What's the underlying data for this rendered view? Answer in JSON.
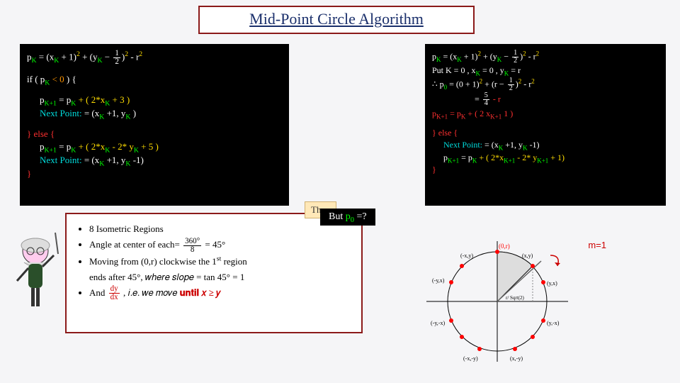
{
  "title": "Mid-Point Circle Algorithm",
  "left_code": {
    "l1a": "p",
    "l1b": "K",
    "l1c": " = (x",
    "l1d": "K",
    "l1e": " + 1)",
    "l1f": "2",
    "l1g": " +  (y",
    "l1h": "K",
    "l1i": " − ",
    "l1j_num": "1",
    "l1j_den": "2",
    "l1k": ")",
    "l1l": "2",
    "l1m": " - r",
    "l1n": "2",
    "l3a": "if ( ",
    "l3b": "p",
    "l3c": "K",
    "l3d": " < 0",
    "l3e": " ) {",
    "l5a": "p",
    "l5b": "K+1",
    "l5c": " = p",
    "l5d": "K",
    "l5e": " + ( 2*x",
    "l5f": "K",
    "l5g": " + 3 )",
    "l6a": "Next Point: ",
    "l6b": "= (x",
    "l6c": "K",
    "l6d": " +1, y",
    "l6e": "K",
    "l6f": " )",
    "l8a": "} else {",
    "l9a": "p",
    "l9b": "K+1",
    "l9c": " = p",
    "l9d": "K",
    "l9e": " + ( 2*x",
    "l9f": "K",
    "l9g": " -  2* y",
    "l9h": "K",
    "l9i": " + 5 )",
    "l10a": "Next Point: ",
    "l10b": "= (x",
    "l10c": "K",
    "l10d": " +1, y",
    "l10e": "K",
    "l10f": " -1)",
    "l11a": "}"
  },
  "right_code": {
    "r1a": "p",
    "r1b": "K",
    "r1c": " = (x",
    "r1d": "K",
    "r1e": " + 1)",
    "r1f": "2",
    "r1g": " +  (y",
    "r1h": "K",
    "r1i": " − ",
    "r1j_num": "1",
    "r1j_den": "2",
    "r1k": ")",
    "r1l": "2",
    "r1m": " - r",
    "r1n": "2",
    "r2a": "Put K = 0 , x",
    "r2b": "K",
    "r2c": " = 0 , y",
    "r2d": "K",
    "r2e": " = r",
    "r3a": "∴ p",
    "r3b": "0",
    "r3c": " = (0 + 1)",
    "r3d": "2",
    "r3e": " +  (r − ",
    "r3f_num": "1",
    "r3f_den": "2",
    "r3g": ")",
    "r3h": "2",
    "r3i": " - r",
    "r3j": "2",
    "r4a": "= ",
    "r4b_num": "5",
    "r4b_den": "4",
    "r4c": " - r",
    "r5a": "p",
    "r5b": "K+1",
    "r5c": " = p",
    "r5d": "K",
    "r5e": " + ( 2   x",
    "r5f": "K+1",
    "r5g": "   1 )",
    "r7a": "} else {",
    "r8a": "Next Point: ",
    "r8b": "= (x",
    "r8c": "K",
    "r8d": " +1, y",
    "r8e": "K",
    "r8f": " -1)",
    "r9a": "p",
    "r9b": "K+1",
    "r9c": " = p",
    "r9d": "K",
    "r9e": " + ( 2*x",
    "r9f": "K+1",
    "r9g": " -  2* y",
    "r9h": "K+1",
    "r9i": " + 1)",
    "r10a": "}"
  },
  "iso": {
    "b1": "8 Isometric Regions",
    "b2a": "Angle at center of each= ",
    "b2b_num": "360°",
    "b2b_den": "8",
    "b2c": " = 45°",
    "b3a": "Moving from (0,r) clockwise the 1",
    "b3b": "st",
    "b3c": " region",
    "b3d": "ends after 45°, 𝑤ℎ𝑒𝑟𝑒 𝑠𝑙𝑜𝑝𝑒 ",
    "b3e": " = tan 45° = 1",
    "b4a": "And ",
    "b4b_num": "dy",
    "b4b_den": "dx",
    "b4c": " , 𝑖.𝑒. 𝑤𝑒 𝑚𝑜𝑣𝑒",
    "b4d": " 𝐮𝐧𝐭𝐢𝐥 𝑥 ≥ 𝑦"
  },
  "then": "Then",
  "but": {
    "a": "But ",
    "b": "p",
    "c": "0",
    "d": " =?"
  },
  "mlabel": "m=1",
  "circle": {
    "top": "(0,r)",
    "p1": "(-x,y)",
    "p2": "(x,y)",
    "p3": "(-y,x)",
    "p4": "(y,x)",
    "p5": "(-y,-x)",
    "p6": "(y,-x)",
    "p7": "(-x,-y)",
    "p8": "(x,-y)",
    "rlabel": "r/ Sqrt(2)"
  }
}
